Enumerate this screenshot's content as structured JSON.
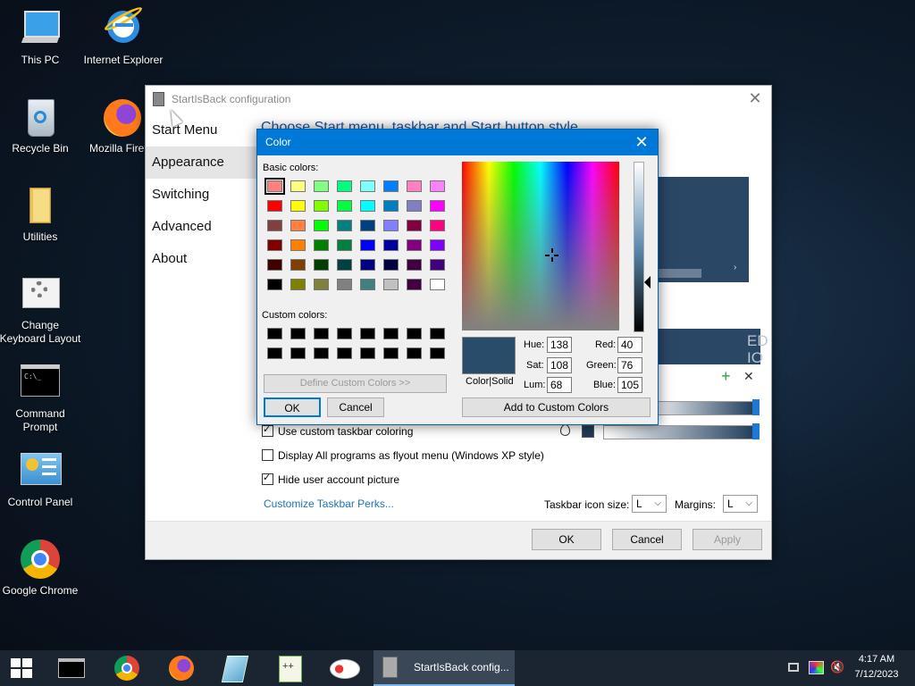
{
  "desktop": {
    "icons": [
      {
        "label": "This PC"
      },
      {
        "label": "Internet Explorer"
      },
      {
        "label": "Recycle Bin"
      },
      {
        "label": "Mozilla Firef"
      },
      {
        "label": "Utilities"
      },
      {
        "label": "Change Keyboard Layout"
      },
      {
        "label": "Command Prompt"
      },
      {
        "label": "Control Panel"
      },
      {
        "label": "Google Chrome"
      }
    ]
  },
  "sib_window": {
    "title": "StartIsBack configuration",
    "nav": [
      {
        "label": "Start Menu"
      },
      {
        "label": "Appearance"
      },
      {
        "label": "Switching"
      },
      {
        "label": "Advanced"
      },
      {
        "label": "About"
      }
    ],
    "selected_nav": "Appearance",
    "heading": "Choose Start menu, taskbar and Start button style",
    "preview_text": "ED\nIO",
    "options": [
      {
        "label": "Use custom taskbar coloring",
        "checked": true
      },
      {
        "label": "Display All programs as flyout menu (Windows XP style)",
        "checked": false
      },
      {
        "label": "Hide user account picture",
        "checked": true
      }
    ],
    "link": "Customize Taskbar Perks...",
    "taskbar_icon_size_label": "Taskbar icon size:",
    "taskbar_icon_size_value": "L",
    "margins_label": "Margins:",
    "margins_value": "L",
    "buttons": {
      "ok": "OK",
      "cancel": "Cancel",
      "apply": "Apply"
    },
    "taskbar_color": "#1f3a58"
  },
  "color_dialog": {
    "title": "Color",
    "basic_colors_label": "Basic colors:",
    "basic_colors": [
      [
        "#ff8080",
        "#ffff80",
        "#80ff80",
        "#00ff80",
        "#80ffff",
        "#0080ff",
        "#ff80c0",
        "#ff80ff"
      ],
      [
        "#ff0000",
        "#ffff00",
        "#80ff00",
        "#00ff40",
        "#00ffff",
        "#0080c0",
        "#8080c0",
        "#ff00ff"
      ],
      [
        "#804040",
        "#ff8040",
        "#00ff00",
        "#008080",
        "#004080",
        "#8080ff",
        "#800040",
        "#ff0080"
      ],
      [
        "#800000",
        "#ff8000",
        "#008000",
        "#008040",
        "#0000ff",
        "#0000a0",
        "#800080",
        "#8000ff"
      ],
      [
        "#400000",
        "#804000",
        "#004000",
        "#004040",
        "#000080",
        "#000040",
        "#400040",
        "#400080"
      ],
      [
        "#000000",
        "#808000",
        "#808040",
        "#808080",
        "#408080",
        "#c0c0c0",
        "#400040",
        "#ffffff"
      ]
    ],
    "custom_colors_label": "Custom colors:",
    "custom_colors": [
      [
        "#000000",
        "#000000",
        "#000000",
        "#000000",
        "#000000",
        "#000000",
        "#000000",
        "#000000"
      ],
      [
        "#000000",
        "#000000",
        "#000000",
        "#000000",
        "#000000",
        "#000000",
        "#000000",
        "#000000"
      ]
    ],
    "define_custom_label": "Define Custom Colors >>",
    "ok_label": "OK",
    "cancel_label": "Cancel",
    "color_solid_label": "Color|Solid",
    "preview_color": "#284c69",
    "fields": {
      "hue_label": "Hue:",
      "hue": "138",
      "sat_label": "Sat:",
      "sat": "108",
      "lum_label": "Lum:",
      "lum": "68",
      "red_label": "Red:",
      "red": "40",
      "green_label": "Green:",
      "green": "76",
      "blue_label": "Blue:",
      "blue": "105"
    },
    "add_custom_label": "Add to Custom Colors"
  },
  "taskbar": {
    "active_window": "StartIsBack config...",
    "time": "4:17 AM",
    "date": "7/12/2023"
  }
}
